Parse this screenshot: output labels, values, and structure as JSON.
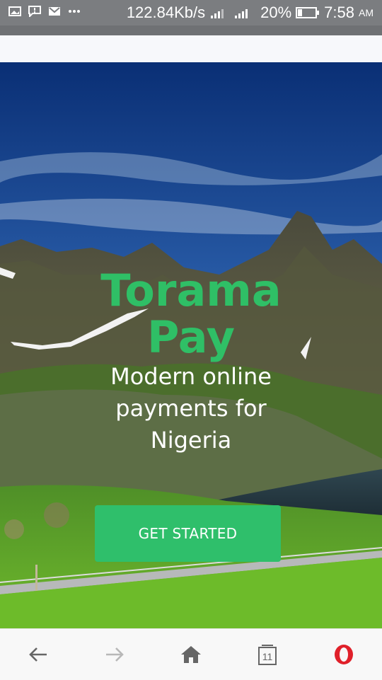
{
  "status_bar": {
    "speed": "122.84Kb/s",
    "battery": "20%",
    "time": "7:58",
    "am_pm": "AM",
    "icons": [
      "gallery-icon",
      "message-icon",
      "mail-icon",
      "more-icon",
      "signal-icon",
      "battery-icon"
    ]
  },
  "hero": {
    "brand_line1": "Torama",
    "brand_line2": "Pay",
    "tagline_line1": "Modern online",
    "tagline_line2": "payments for",
    "tagline_line3": "Nigeria",
    "cta_label": "GET STARTED"
  },
  "browser_nav": {
    "tab_count": "11",
    "icons": [
      "back-arrow-icon",
      "forward-arrow-icon",
      "home-icon",
      "tabs-icon",
      "opera-icon"
    ]
  },
  "colors": {
    "brand_green": "#2fbf66",
    "button_green": "#2fbf6b",
    "status_bar": "#7b7d80"
  }
}
